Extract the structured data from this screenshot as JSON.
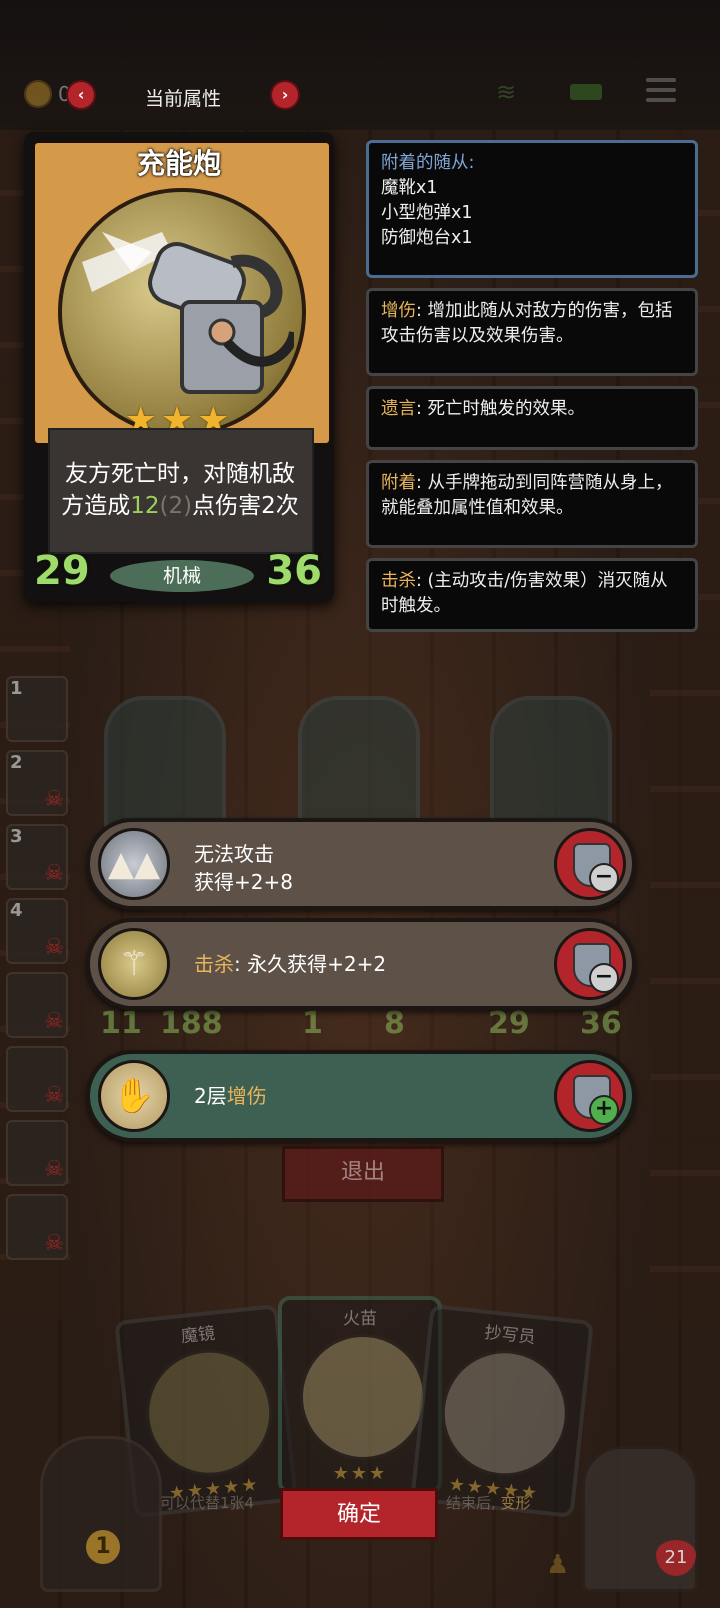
{
  "header": {
    "title": "当前属性",
    "coin_value": "0",
    "prev_label": "‹",
    "next_label": "›"
  },
  "card": {
    "name": "充能炮",
    "stars": "★★★",
    "desc_part1": "友方死亡时，对随机敌方造成",
    "desc_value": "12",
    "desc_bonus": "(2)",
    "desc_part2": "点伤害2次",
    "attack": "29",
    "health": "36",
    "tribe": "机械"
  },
  "info": {
    "attached": {
      "title": "附着的随从:",
      "items": [
        "魔靴x1",
        "小型炮弹x1",
        "防御炮台x1"
      ]
    },
    "panels": [
      {
        "keyword": "增伤",
        "text": ": 增加此随从对敌方的伤害，包括攻击伤害以及效果伤害。"
      },
      {
        "keyword": "遗言",
        "text": ": 死亡时触发的效果。"
      },
      {
        "keyword": "附着",
        "text": ": 从手牌拖动到同阵营随从身上，就能叠加属性值和效果。"
      },
      {
        "keyword": "击杀",
        "text": ": (主动攻击/伤害效果）消灭随从时触发。"
      }
    ]
  },
  "queue": [
    "1",
    "2",
    "3",
    "4"
  ],
  "board_stats": [
    "11",
    "188",
    "1",
    "8",
    "29",
    "36"
  ],
  "effects": [
    {
      "line1": "无法攻击",
      "line2": "获得+2+8",
      "icon": "spikes-icon",
      "action": "minus"
    },
    {
      "keyword": "击杀",
      "text": ": 永久获得+2+2",
      "icon": "scythe-icon",
      "action": "minus"
    },
    {
      "prefix": "2层",
      "keyword": "增伤",
      "icon": "flame-hand-icon",
      "action": "plus"
    }
  ],
  "exit_label": "退出",
  "hand": [
    {
      "name": "魔镜",
      "stars": "★★★★★",
      "note": "可以代替1张4"
    },
    {
      "name": "火苗",
      "stars": "★★★"
    },
    {
      "name": "抄写员",
      "stars": "★★★★★",
      "note_prefix": "结束后, ",
      "note_keyword": "变形"
    }
  ],
  "confirm_label": "确定",
  "deck_count": "1",
  "hero_hp": "21",
  "colors": {
    "accent_red": "#b3252a",
    "keyword_gold": "#e8b55b",
    "stat_green": "#9fdb6a"
  }
}
